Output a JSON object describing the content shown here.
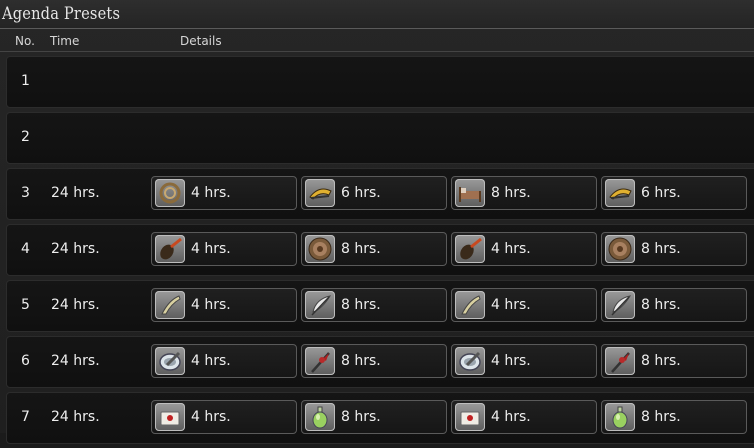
{
  "window": {
    "title": "Agenda Presets"
  },
  "columns": {
    "no": "No.",
    "time": "Time",
    "details": "Details"
  },
  "rows": [
    {
      "no": "1",
      "time": "",
      "slots": []
    },
    {
      "no": "2",
      "time": "",
      "slots": []
    },
    {
      "no": "3",
      "time": "24 hrs.",
      "slots": [
        {
          "icon": "rope-coil-icon",
          "hours": "4 hrs."
        },
        {
          "icon": "horn-icon",
          "hours": "6 hrs."
        },
        {
          "icon": "bed-icon",
          "hours": "8 hrs."
        },
        {
          "icon": "horn-icon",
          "hours": "6 hrs."
        }
      ]
    },
    {
      "no": "4",
      "time": "24 hrs.",
      "slots": [
        {
          "icon": "brush-icon",
          "hours": "4 hrs."
        },
        {
          "icon": "round-shield-icon",
          "hours": "8 hrs."
        },
        {
          "icon": "brush-icon",
          "hours": "4 hrs."
        },
        {
          "icon": "round-shield-icon",
          "hours": "8 hrs."
        }
      ]
    },
    {
      "no": "5",
      "time": "24 hrs.",
      "slots": [
        {
          "icon": "fang-icon",
          "hours": "4 hrs."
        },
        {
          "icon": "feather-icon",
          "hours": "8 hrs."
        },
        {
          "icon": "fang-icon",
          "hours": "4 hrs."
        },
        {
          "icon": "feather-icon",
          "hours": "8 hrs."
        }
      ]
    },
    {
      "no": "6",
      "time": "24 hrs.",
      "slots": [
        {
          "icon": "mortar-pestle-icon",
          "hours": "4 hrs."
        },
        {
          "icon": "spear-icon",
          "hours": "8 hrs."
        },
        {
          "icon": "mortar-pestle-icon",
          "hours": "4 hrs."
        },
        {
          "icon": "spear-icon",
          "hours": "8 hrs."
        }
      ]
    },
    {
      "no": "7",
      "time": "24 hrs.",
      "slots": [
        {
          "icon": "envelope-icon",
          "hours": "4 hrs."
        },
        {
          "icon": "potion-bottle-icon",
          "hours": "8 hrs."
        },
        {
          "icon": "envelope-icon",
          "hours": "4 hrs."
        },
        {
          "icon": "potion-bottle-icon",
          "hours": "8 hrs."
        }
      ]
    }
  ]
}
